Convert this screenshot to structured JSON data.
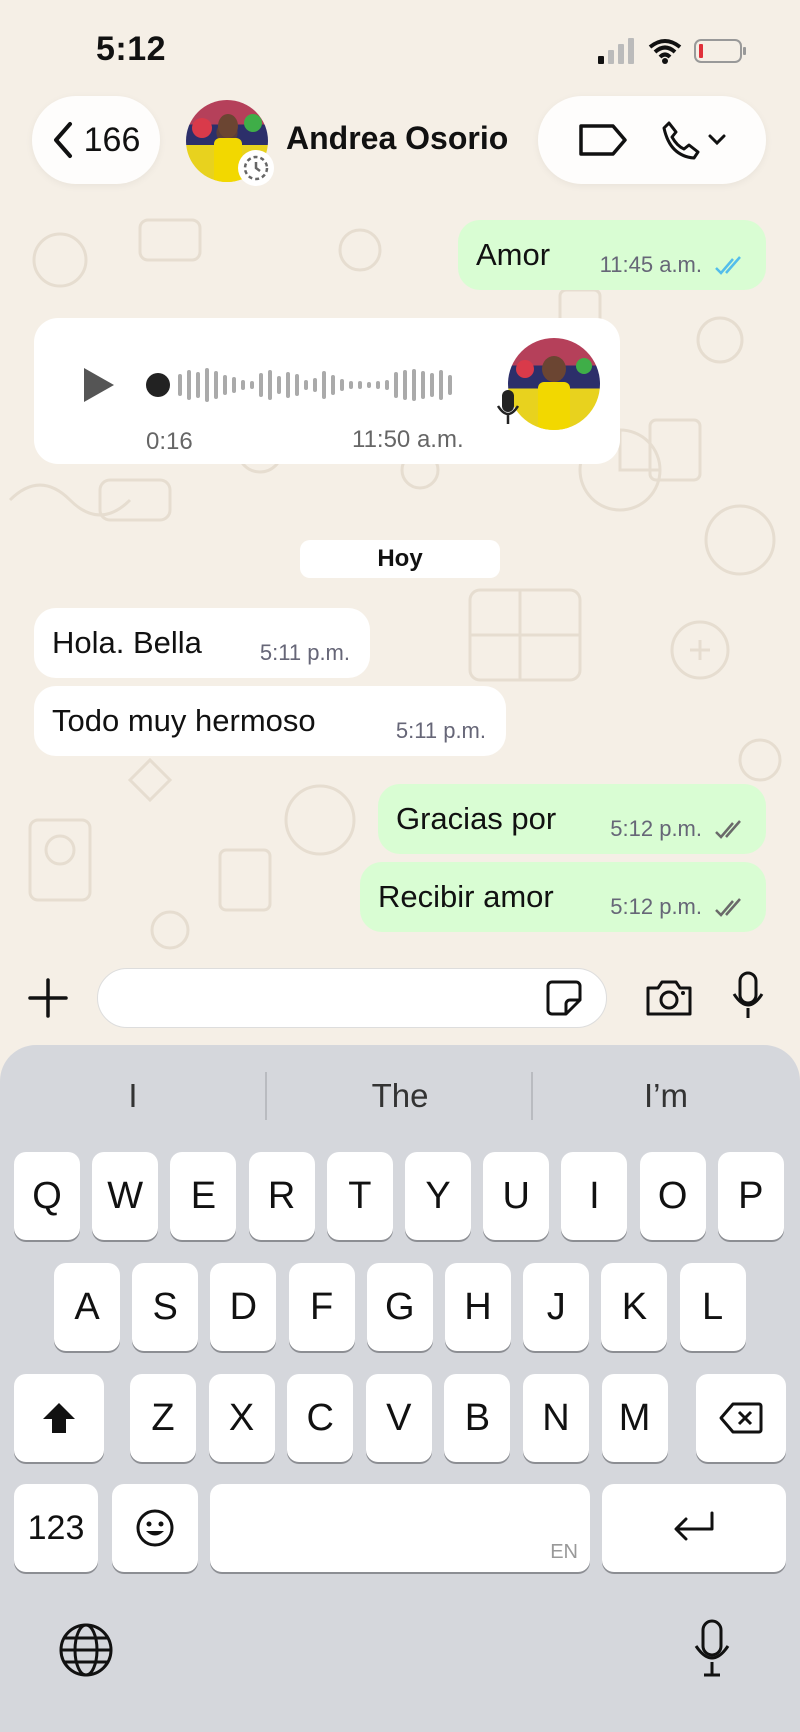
{
  "status_bar": {
    "time": "5:12"
  },
  "header": {
    "back_count": "166",
    "contact_name": "Andrea Osorio"
  },
  "messages": [
    {
      "type": "out",
      "text": "Amor",
      "time": "11:45 a.m."
    },
    {
      "type": "voice",
      "duration": "0:16",
      "time": "11:50 a.m."
    },
    {
      "type": "date",
      "text": "Hoy"
    },
    {
      "type": "in",
      "text": "Hola. Bella",
      "time": "5:11 p.m."
    },
    {
      "type": "in",
      "text": "Todo muy hermoso",
      "time": "5:11 p.m."
    },
    {
      "type": "out",
      "text": "Gracias por",
      "time": "5:12 p.m."
    },
    {
      "type": "out",
      "text": "Recibir amor",
      "time": "5:12 p.m."
    }
  ],
  "composer": {
    "placeholder": ""
  },
  "keyboard": {
    "suggestions": [
      "I",
      "The",
      "I’m"
    ],
    "row1": [
      "Q",
      "W",
      "E",
      "R",
      "T",
      "Y",
      "U",
      "I",
      "O",
      "P"
    ],
    "row2": [
      "A",
      "S",
      "D",
      "F",
      "G",
      "H",
      "J",
      "K",
      "L"
    ],
    "row3": [
      "Z",
      "X",
      "C",
      "V",
      "B",
      "N",
      "M"
    ],
    "numbers_key": "123",
    "space_lang": "EN"
  },
  "colors": {
    "outgoing": "#d9fdd3",
    "incoming": "#ffffff",
    "read_tick": "#53bdeb",
    "background": "#f5efe6",
    "keyboard": "#d5d7dc"
  },
  "icons": [
    "signal-icon",
    "wifi-icon",
    "battery-icon",
    "back-chevron-icon",
    "status-ring-icon",
    "label-icon",
    "phone-icon",
    "chevron-down-icon",
    "play-icon",
    "mic-icon",
    "plus-icon",
    "sticker-icon",
    "camera-icon",
    "shift-icon",
    "backspace-icon",
    "emoji-icon",
    "return-icon",
    "globe-icon",
    "dictation-icon"
  ]
}
